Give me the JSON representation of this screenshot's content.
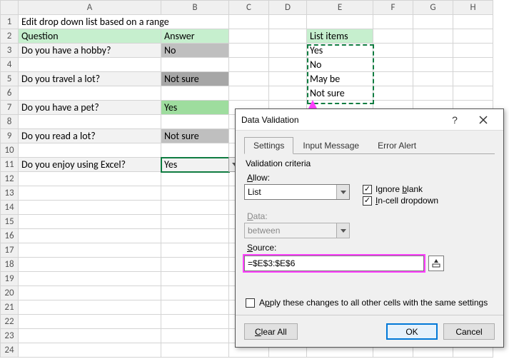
{
  "columns": [
    "A",
    "B",
    "C",
    "D",
    "E",
    "F",
    "G",
    "H"
  ],
  "rows_count": 24,
  "title": "Edit drop down list based on a range",
  "headers": {
    "question": "Question",
    "answer": "Answer",
    "list": "List items"
  },
  "questions": {
    "r3": "Do you have a hobby?",
    "r5": "Do you travel a lot?",
    "r7": "Do you have a pet?",
    "r9": "Do you read a lot?",
    "r11": "Do you enjoy using Excel?"
  },
  "answers": {
    "r3": "No",
    "r5": "Not sure",
    "r7": "Yes",
    "r9": "Not sure",
    "r11": "Yes"
  },
  "list_items": {
    "e3": "Yes",
    "e4": "No",
    "e5": "May be",
    "e6": "Not sure"
  },
  "active_cell": "B11",
  "marching_range": "E3:E6",
  "dialog": {
    "title": "Data Validation",
    "tabs": {
      "settings": "Settings",
      "input": "Input Message",
      "error": "Error Alert"
    },
    "criteria_label": "Validation criteria",
    "allow_label": "Allow:",
    "allow_value": "List",
    "data_label": "Data:",
    "data_value": "between",
    "source_label": "Source:",
    "source_value": "=$E$3:$E$6",
    "ignore_blank": "Ignore blank",
    "incell_dd": "In-cell dropdown",
    "apply_all": "Apply these changes to all other cells with the same settings",
    "clear": "Clear All",
    "ok": "OK",
    "cancel": "Cancel"
  }
}
